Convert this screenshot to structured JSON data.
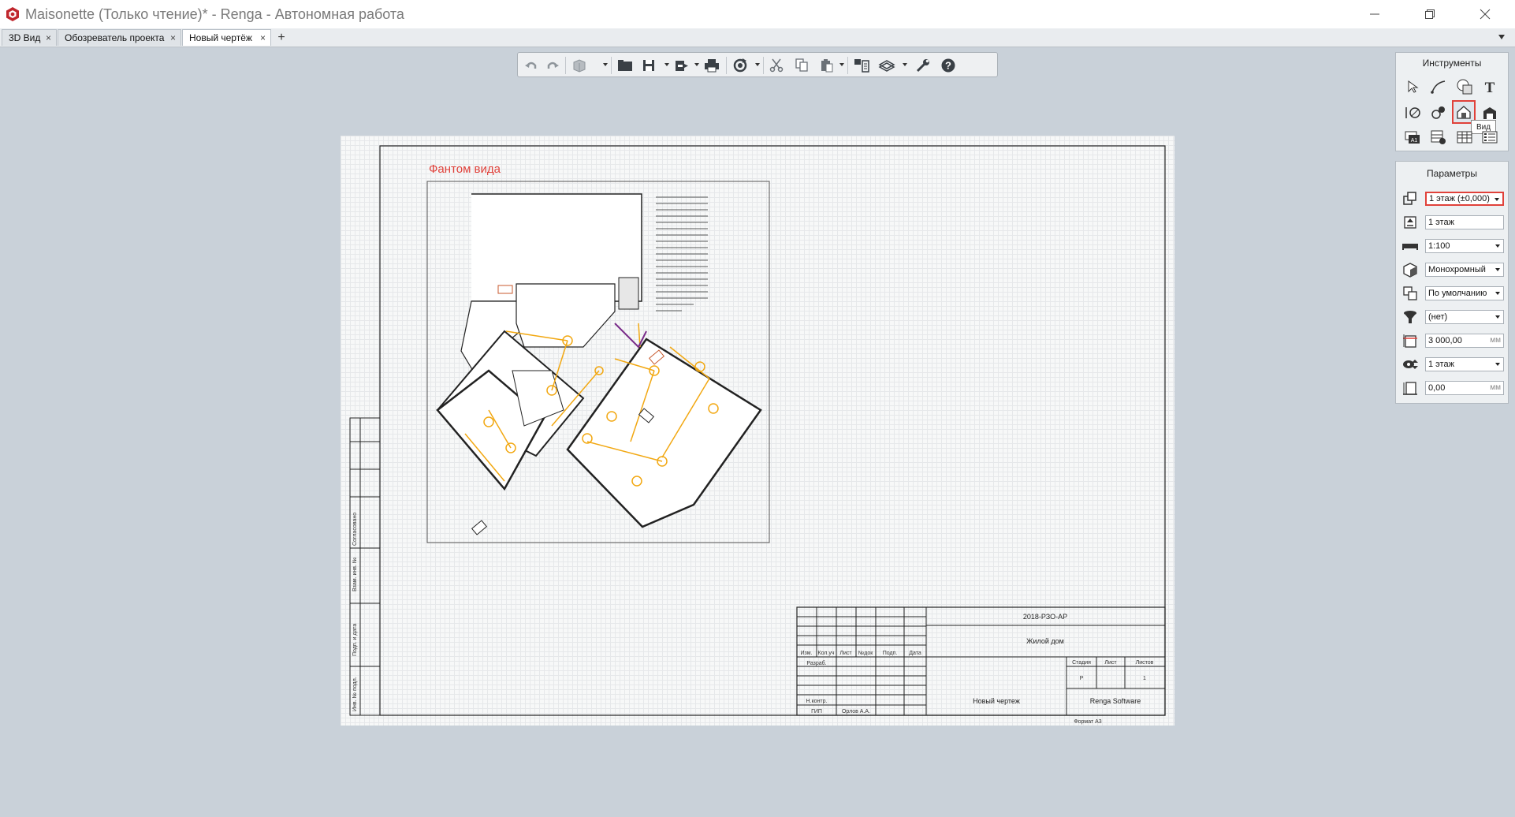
{
  "window": {
    "title": "Maisonette (Только чтение)* - Renga - Автономная работа",
    "controls": [
      "minimize-icon",
      "restore-icon",
      "close-icon"
    ]
  },
  "tabs": [
    {
      "label": "3D Вид",
      "active": false
    },
    {
      "label": "Обозреватель проекта",
      "active": false
    },
    {
      "label": "Новый чертёж",
      "active": true
    }
  ],
  "tab_add": "+",
  "tab_close": "×",
  "toolbar": {
    "buttons": [
      "undo-icon",
      "redo-icon",
      "model-icon",
      "open-icon",
      "save-icon",
      "export-icon",
      "print-icon",
      "sync-icon",
      "cut-icon",
      "copy-icon",
      "paste-icon",
      "layers-icon",
      "view-cube-icon",
      "settings-icon",
      "help-icon"
    ]
  },
  "drawing": {
    "phantom_label": "Фантом вида",
    "title_block": {
      "doc_code": "2018-РЗО-АР",
      "project_name": "Жилой дом",
      "sheet_name": "Новый чертеж",
      "company": "Renga Software",
      "stage_header": "Стадия",
      "sheet_header": "Лист",
      "sheets_header": "Листов",
      "stage_value": "Р",
      "sheets_value": "1",
      "col_headers": [
        "Изм.",
        "Кол.уч",
        "Лист",
        "№док",
        "Подп.",
        "Дата"
      ],
      "row_developed": "Разраб.",
      "row_norm_control": "Н.контр.",
      "row_gip": "ГИП",
      "gip_name": "Орлов А.А.",
      "format": "Формат А3"
    },
    "side_stamp": [
      "Инв. № подл.",
      "Подп. и дата",
      "Взам. инв. №",
      "Согласовано"
    ]
  },
  "tools_panel": {
    "title": "Инструменты",
    "tooltip": "Вид",
    "icons": [
      "select-icon",
      "line-icon",
      "hatch-icon",
      "text-icon",
      "dimension-icon",
      "elevation-icon",
      "view-icon",
      "section-icon",
      "sheet-a1-icon",
      "table-icon",
      "grid-table-icon",
      "spec-icon"
    ]
  },
  "params_panel": {
    "title": "Параметры",
    "fields": [
      {
        "icon": "view-level-icon",
        "value": "1 этаж (±0,000)",
        "dropdown": true,
        "highlight": true
      },
      {
        "icon": "level-name-icon",
        "value": "1 этаж",
        "dropdown": false
      },
      {
        "icon": "scale-icon",
        "value": "1:100",
        "dropdown": true
      },
      {
        "icon": "display-style-icon",
        "value": "Монохромный",
        "dropdown": true
      },
      {
        "icon": "view-style-icon",
        "value": "По умолчанию",
        "dropdown": true
      },
      {
        "icon": "filter-icon",
        "value": "(нет)",
        "dropdown": true
      },
      {
        "icon": "cut-height-icon",
        "value": "3 000,00",
        "unit": "мм"
      },
      {
        "icon": "visibility-icon",
        "value": "1 этаж",
        "dropdown": true
      },
      {
        "icon": "offset-icon",
        "value": "0,00",
        "unit": "мм"
      }
    ]
  }
}
